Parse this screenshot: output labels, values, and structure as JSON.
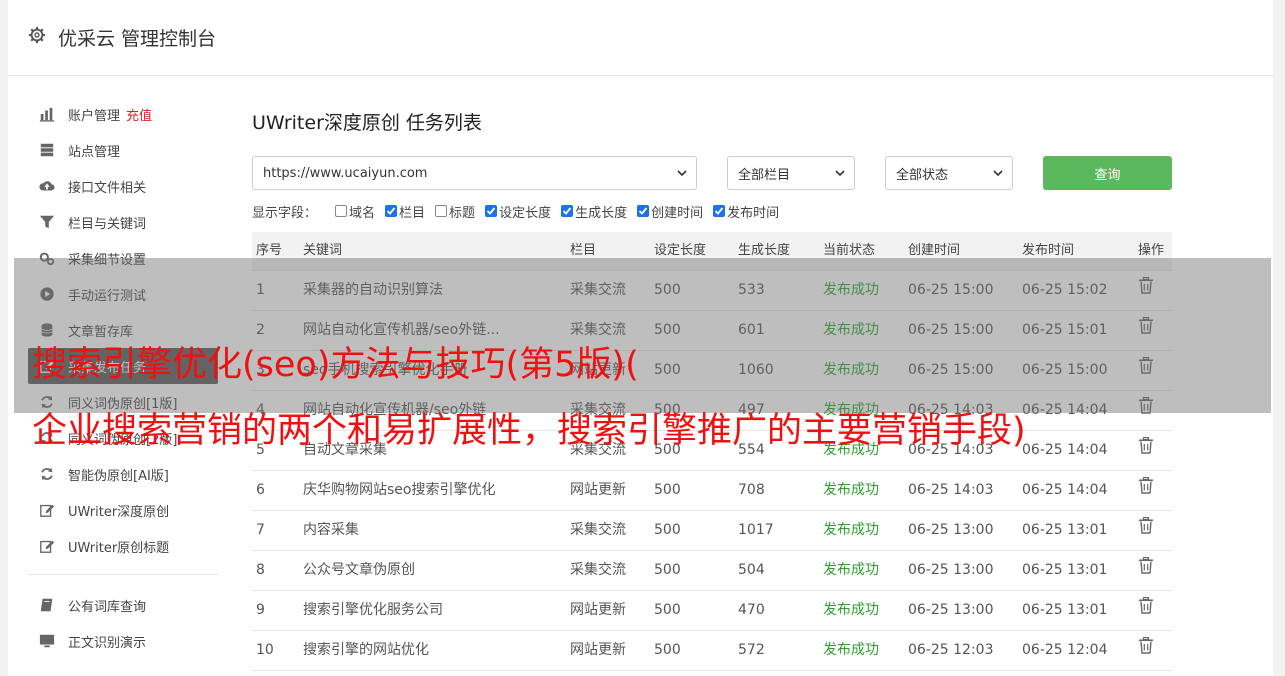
{
  "header": {
    "title": "优采云 管理控制台"
  },
  "sidebar": {
    "groups": [
      [
        {
          "label": "账户管理",
          "extra": "充值",
          "icon": "bar-chart-icon"
        },
        {
          "label": "站点管理",
          "icon": "server-icon"
        },
        {
          "label": "接口文件相关",
          "icon": "cloud-upload-icon"
        },
        {
          "label": "栏目与关键词",
          "icon": "filter-icon"
        },
        {
          "label": "采集细节设置",
          "icon": "gears-icon"
        },
        {
          "label": "手动运行测试",
          "icon": "play-circle-icon"
        },
        {
          "label": "文章暂存库",
          "icon": "database-icon"
        },
        {
          "label": "采集发布任务",
          "icon": "edit-icon",
          "active": true
        },
        {
          "label": "同义词伪原创[1版]",
          "icon": "refresh-icon"
        },
        {
          "label": "同义词伪原创[2版]",
          "icon": "refresh-icon"
        },
        {
          "label": "智能伪原创[AI版]",
          "icon": "refresh-icon"
        },
        {
          "label": "UWriter深度原创",
          "icon": "edit-icon"
        },
        {
          "label": "UWriter原创标题",
          "icon": "edit-icon"
        }
      ],
      [
        {
          "label": "公有词库查询",
          "icon": "book-icon"
        },
        {
          "label": "正文识别演示",
          "icon": "monitor-icon"
        }
      ]
    ]
  },
  "main": {
    "title": "UWriter深度原创 任务列表",
    "site_select": "https://www.ucaiyun.com",
    "column_select": "全部栏目",
    "status_select": "全部状态",
    "query_label": "查询",
    "fields_label": "显示字段：",
    "fields": [
      {
        "label": "域名",
        "checked": false
      },
      {
        "label": "栏目",
        "checked": true
      },
      {
        "label": "标题",
        "checked": false
      },
      {
        "label": "设定长度",
        "checked": true
      },
      {
        "label": "生成长度",
        "checked": true
      },
      {
        "label": "创建时间",
        "checked": true
      },
      {
        "label": "发布时间",
        "checked": true
      }
    ],
    "columns": [
      "序号",
      "关键词",
      "栏目",
      "设定长度",
      "生成长度",
      "当前状态",
      "创建时间",
      "发布时间",
      "操作"
    ],
    "rows": [
      [
        "1",
        "采集器的自动识别算法",
        "采集交流",
        "500",
        "533",
        "发布成功",
        "06-25 15:00",
        "06-25 15:02"
      ],
      [
        "2",
        "网站自动化宣传机器/seo外链...",
        "采集交流",
        "500",
        "601",
        "发布成功",
        "06-25 15:00",
        "06-25 15:01"
      ],
      [
        "3",
        "seo手机搜索引擎优化手册",
        "网站更新",
        "500",
        "1060",
        "发布成功",
        "06-25 15:00",
        "06-25 15:00"
      ],
      [
        "4",
        "网站自动化宣传机器/seo外链",
        "采集交流",
        "500",
        "497",
        "发布成功",
        "06-25 14:03",
        "06-25 14:04"
      ],
      [
        "5",
        "自动文章采集",
        "采集交流",
        "500",
        "554",
        "发布成功",
        "06-25 14:03",
        "06-25 14:04"
      ],
      [
        "6",
        "庆华购物网站seo搜索引擎优化",
        "网站更新",
        "500",
        "708",
        "发布成功",
        "06-25 14:03",
        "06-25 14:04"
      ],
      [
        "7",
        "内容采集",
        "采集交流",
        "500",
        "1017",
        "发布成功",
        "06-25 13:00",
        "06-25 13:01"
      ],
      [
        "8",
        "公众号文章伪原创",
        "采集交流",
        "500",
        "504",
        "发布成功",
        "06-25 13:00",
        "06-25 13:01"
      ],
      [
        "9",
        "搜索引擎优化服务公司",
        "网站更新",
        "500",
        "470",
        "发布成功",
        "06-25 13:00",
        "06-25 13:01"
      ],
      [
        "10",
        "搜索引擎的网站优化",
        "网站更新",
        "500",
        "572",
        "发布成功",
        "06-25 12:03",
        "06-25 12:04"
      ]
    ]
  },
  "overlay": {
    "line1": "搜索引擎优化(seo)方法与技巧(第5版)(",
    "line2": "企业搜索营销的两个和易扩展性，搜索引擎推广的主要营销手段)"
  }
}
